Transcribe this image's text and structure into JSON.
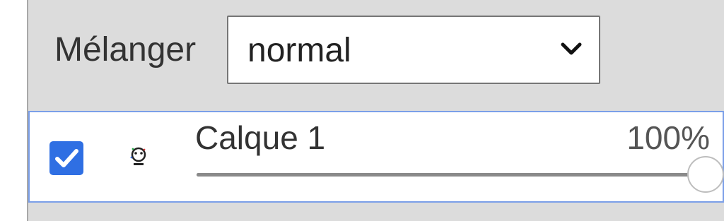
{
  "blend": {
    "label": "Mélanger",
    "selected": "normal"
  },
  "layer": {
    "name": "Calque 1",
    "opacity_text": "100%",
    "opacity_value": 1.0,
    "visible": true
  },
  "colors": {
    "panel_bg": "#dcdcdc",
    "accent": "#2f6fe3",
    "row_border": "#7b9fe8"
  }
}
